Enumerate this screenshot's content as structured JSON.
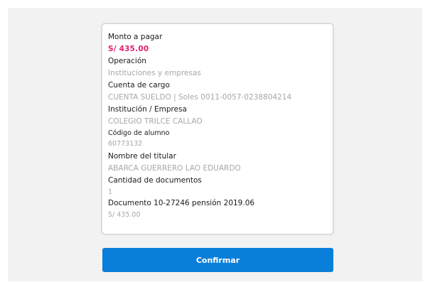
{
  "summary": {
    "amount_label": "Monto a pagar",
    "amount_value": "S/ 435.00",
    "operation_label": "Operación",
    "operation_value": "Instituciones y empresas",
    "account_label": "Cuenta de cargo",
    "account_value": "CUENTA SUELDO | Soles 0011-0057-0238804214",
    "institution_label": "Institución / Empresa",
    "institution_value": "COLEGIO TRILCE CALLAO",
    "student_code_label": "Código de alumno",
    "student_code_value": "60773132",
    "holder_label": "Nombre del titular",
    "holder_value": "ABARCA GUERRERO LAO EDUARDO",
    "doc_count_label": "Cantidad de documentos",
    "doc_count_value": "1",
    "document_label": "Documento 10-27246  pensión 2019.06",
    "document_value": "S/ 435.00"
  },
  "actions": {
    "confirm_label": "Confirmar"
  },
  "colors": {
    "accent_amount": "#e5206f",
    "button_blue": "#0a7fd9"
  }
}
